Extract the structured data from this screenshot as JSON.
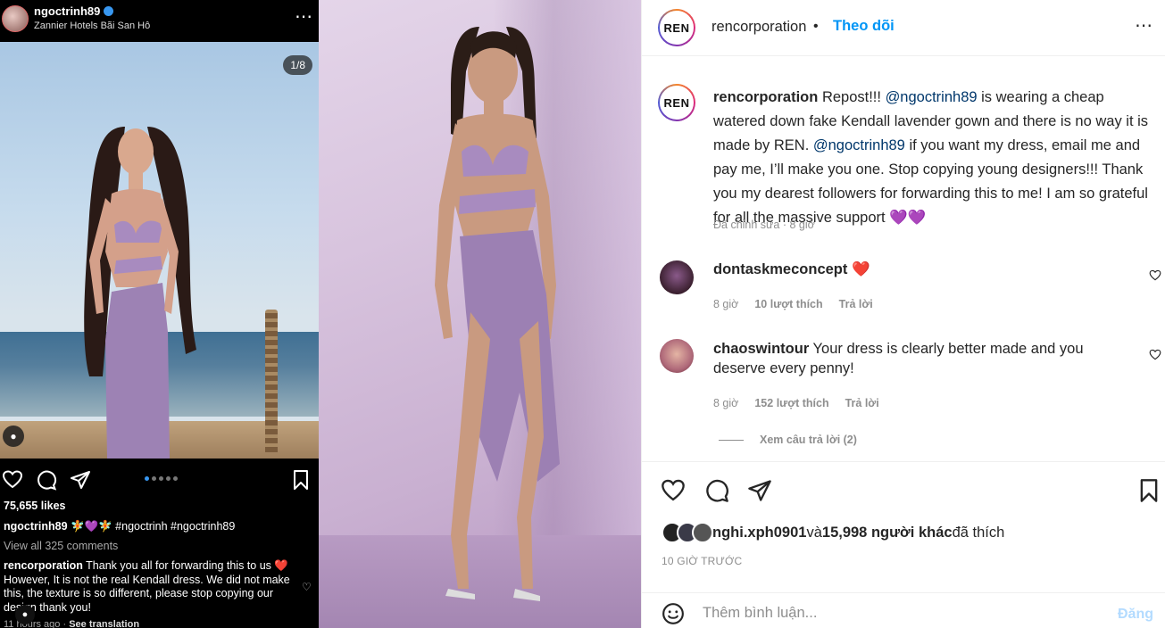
{
  "left_panel": {
    "username": "ngoctrinh89",
    "location": "Zannier Hotels Bãi San Hô",
    "more_icon": "⋯",
    "counter": "1/8",
    "likes": "75,655 likes",
    "caption_user": "ngoctrinh89",
    "caption_text": " 🧚💜🧚 #ngoctrinh #ngoctrinh89",
    "view_all": "View all 325 comments",
    "comment_user": "rencorporation",
    "comment_text": " Thank you all for forwarding this to us ❤️ However, It is not the real Kendall dress. We did not make this, the texture is so different, please stop copying our design thank you!",
    "comment_time": "11 hours ago",
    "see_translation": "See translation"
  },
  "post": {
    "avatar_text": "REN",
    "username": "rencorporation",
    "separator": "•",
    "follow_label": "Theo dõi",
    "more_icon": "⋯",
    "caption": {
      "user": "rencorporation",
      "part1": " Repost!!! ",
      "mention1": "@ngoctrinh89",
      "part2": " is wearing a cheap watered down fake Kendall lavender gown and there is no way it is made by REN. ",
      "mention2": "@ngoctrinh89",
      "part3": " if you want my dress, email me and pay me, I’ll make you one. Stop copying young designers!!! Thank you my dearest followers for forwarding this to me! I am so grateful for all the massive support 💜💜"
    },
    "edited": "Đã chỉnh sửa · 8 giờ"
  },
  "comments": [
    {
      "user": "dontaskmeconcept",
      "text": " ❤️",
      "time": "8 giờ",
      "likes": "10 lượt thích",
      "reply": "Trả lời"
    },
    {
      "user": "chaoswintour",
      "text": " Your dress is clearly better made and you deserve every penny!",
      "time": "8 giờ",
      "likes": "152 lượt thích",
      "reply": "Trả lời"
    }
  ],
  "view_replies": "Xem câu trả lời (2)",
  "liked_by": {
    "user": "nghi.xph0901",
    "and": " và ",
    "others": "15,998 người khác",
    "suffix": " đã thích"
  },
  "timestamp": "10 GIỜ TRƯỚC",
  "composer": {
    "placeholder": "Thêm bình luận...",
    "post_label": "Đăng"
  },
  "colors": {
    "link_blue": "#0095f6",
    "mention": "#00376b",
    "muted": "#8e8e8e",
    "dress": "#a88bbf"
  }
}
